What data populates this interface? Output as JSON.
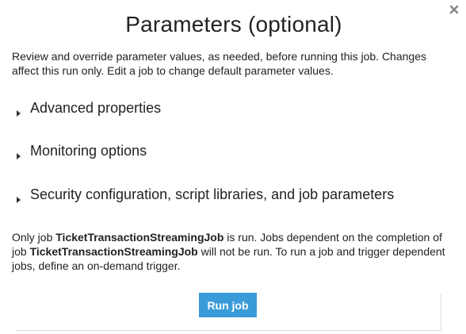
{
  "modal": {
    "title": "Parameters (optional)",
    "description": "Review and override parameter values, as needed, before running this job. Changes affect this run only. Edit a job to change default parameter values.",
    "close_icon": "close-icon"
  },
  "sections": {
    "advanced": "Advanced properties",
    "monitoring": "Monitoring options",
    "security": "Security configuration, script libraries, and job parameters"
  },
  "note": {
    "part1": "Only job ",
    "job_name_1": "TicketTransactionStreamingJob",
    "part2": " is run. Jobs dependent on the completion of job ",
    "job_name_2": "TicketTransactionStreamingJob",
    "part3": " will not be run. To run a job and trigger dependent jobs, define an on-demand trigger."
  },
  "footer": {
    "run_button_label": "Run job",
    "run_button_color": "#3a9bd9"
  }
}
